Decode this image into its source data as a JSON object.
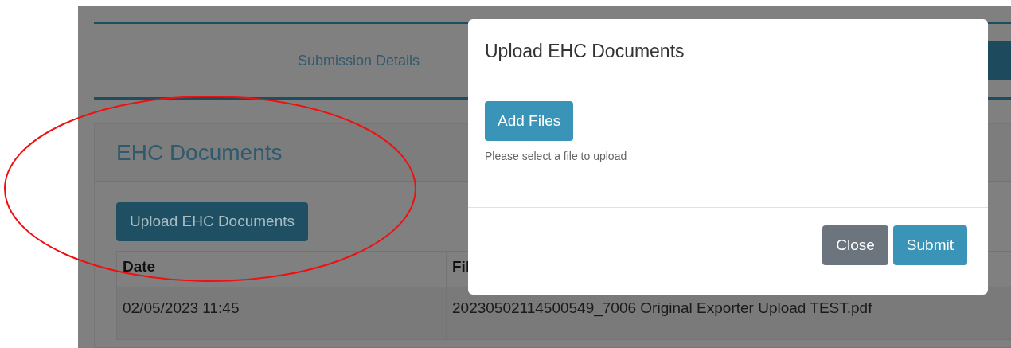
{
  "tabs": [
    {
      "label": "Submission Details",
      "selected": false
    },
    {
      "selected": true
    }
  ],
  "card": {
    "title": "EHC Documents",
    "upload_button": "Upload EHC Documents"
  },
  "table": {
    "columns": [
      "Date",
      "Fil"
    ],
    "rows": [
      [
        "02/05/2023 11:45",
        "20230502114500549_7006 Original Exporter Upload TEST.pdf"
      ]
    ]
  },
  "modal": {
    "title": "Upload EHC Documents",
    "add_button": "Add Files",
    "hint": "Please select a file to upload",
    "buttons": [
      {
        "label": "Close",
        "kind": "secondary"
      },
      {
        "label": "Submit",
        "kind": "primary"
      }
    ]
  }
}
